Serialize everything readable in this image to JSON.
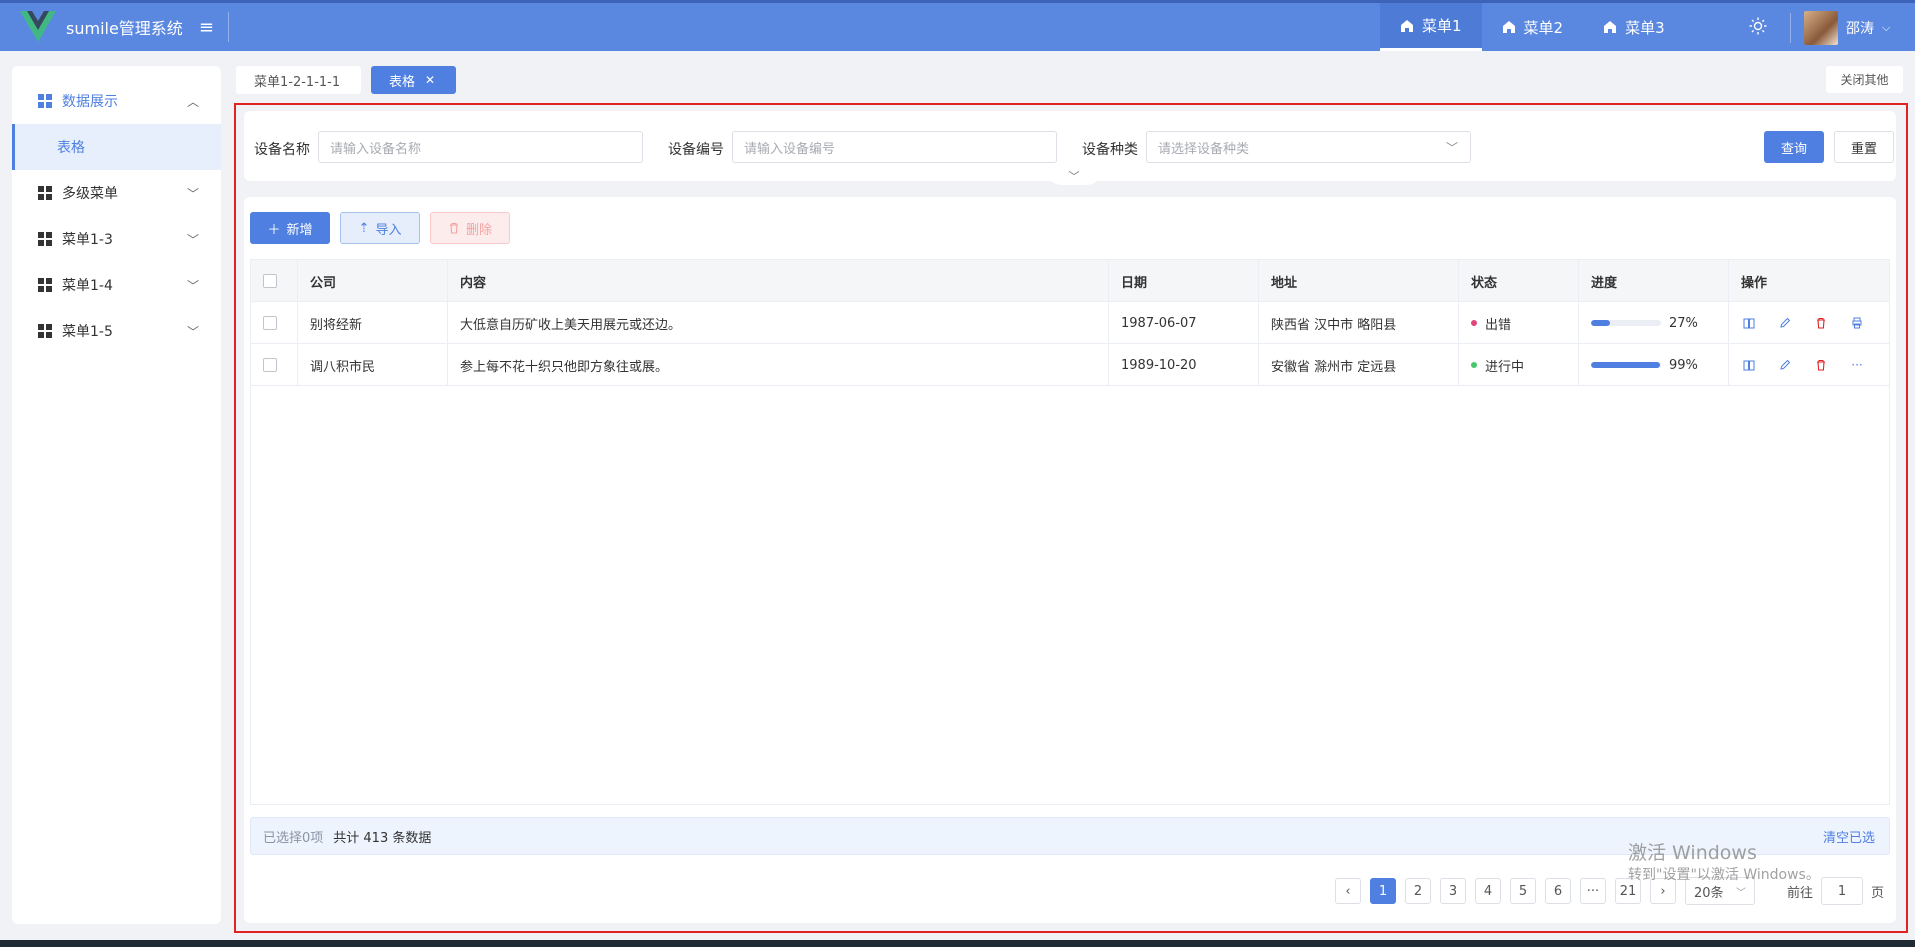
{
  "app": {
    "title": "sumile管理系统"
  },
  "header": {
    "menus": [
      {
        "label": "菜单1",
        "active": true
      },
      {
        "label": "菜单2",
        "active": false
      },
      {
        "label": "菜单3",
        "active": false
      }
    ],
    "user_name": "邵涛"
  },
  "sidebar": {
    "items": [
      {
        "label": "数据展示",
        "open": true
      },
      {
        "label": "表格"
      },
      {
        "label": "多级菜单"
      },
      {
        "label": "菜单1-3"
      },
      {
        "label": "菜单1-4"
      },
      {
        "label": "菜单1-5"
      }
    ]
  },
  "tabs": [
    {
      "label": "菜单1-2-1-1-1",
      "active": false
    },
    {
      "label": "表格",
      "active": true
    }
  ],
  "close_others_label": "关闭其他",
  "filter": {
    "name_label": "设备名称",
    "name_placeholder": "请输入设备名称",
    "code_label": "设备编号",
    "code_placeholder": "请输入设备编号",
    "type_label": "设备种类",
    "type_placeholder": "请选择设备种类",
    "query_label": "查询",
    "reset_label": "重置"
  },
  "toolbar": {
    "add_label": "新增",
    "import_label": "导入",
    "delete_label": "删除"
  },
  "table": {
    "columns": [
      "公司",
      "内容",
      "日期",
      "地址",
      "状态",
      "进度",
      "操作"
    ],
    "rows": [
      {
        "company": "别将经新",
        "content": "大低意自历矿收上美天用展元或还边。",
        "date": "1987-06-07",
        "address": "陕西省 汉中市 略阳县",
        "status": "出错",
        "status_color": "#e0457b",
        "progress": 27,
        "progress_text": "27%"
      },
      {
        "company": "调八积市民",
        "content": "参上每不花十织只他即方象往或展。",
        "date": "1989-10-20",
        "address": "安徽省 滁州市 定远县",
        "status": "进行中",
        "status_color": "#47c66a",
        "progress": 99,
        "progress_text": "99%"
      }
    ]
  },
  "selection": {
    "selected_text": "已选择0项",
    "total_text": "共计 413 条数据",
    "clear_label": "清空已选"
  },
  "pagination": {
    "pages": [
      "1",
      "2",
      "3",
      "4",
      "5",
      "6",
      "···",
      "21"
    ],
    "current": "1",
    "size_label": "20条",
    "goto_prefix": "前往",
    "goto_value": "1",
    "goto_suffix": "页"
  },
  "watermark": {
    "line1": "激活 Windows",
    "line2": "转到\"设置\"以激活 Windows。"
  },
  "colors": {
    "primary": "#4f7fe0",
    "header_bg": "#5a87e0",
    "danger": "#e02222"
  }
}
